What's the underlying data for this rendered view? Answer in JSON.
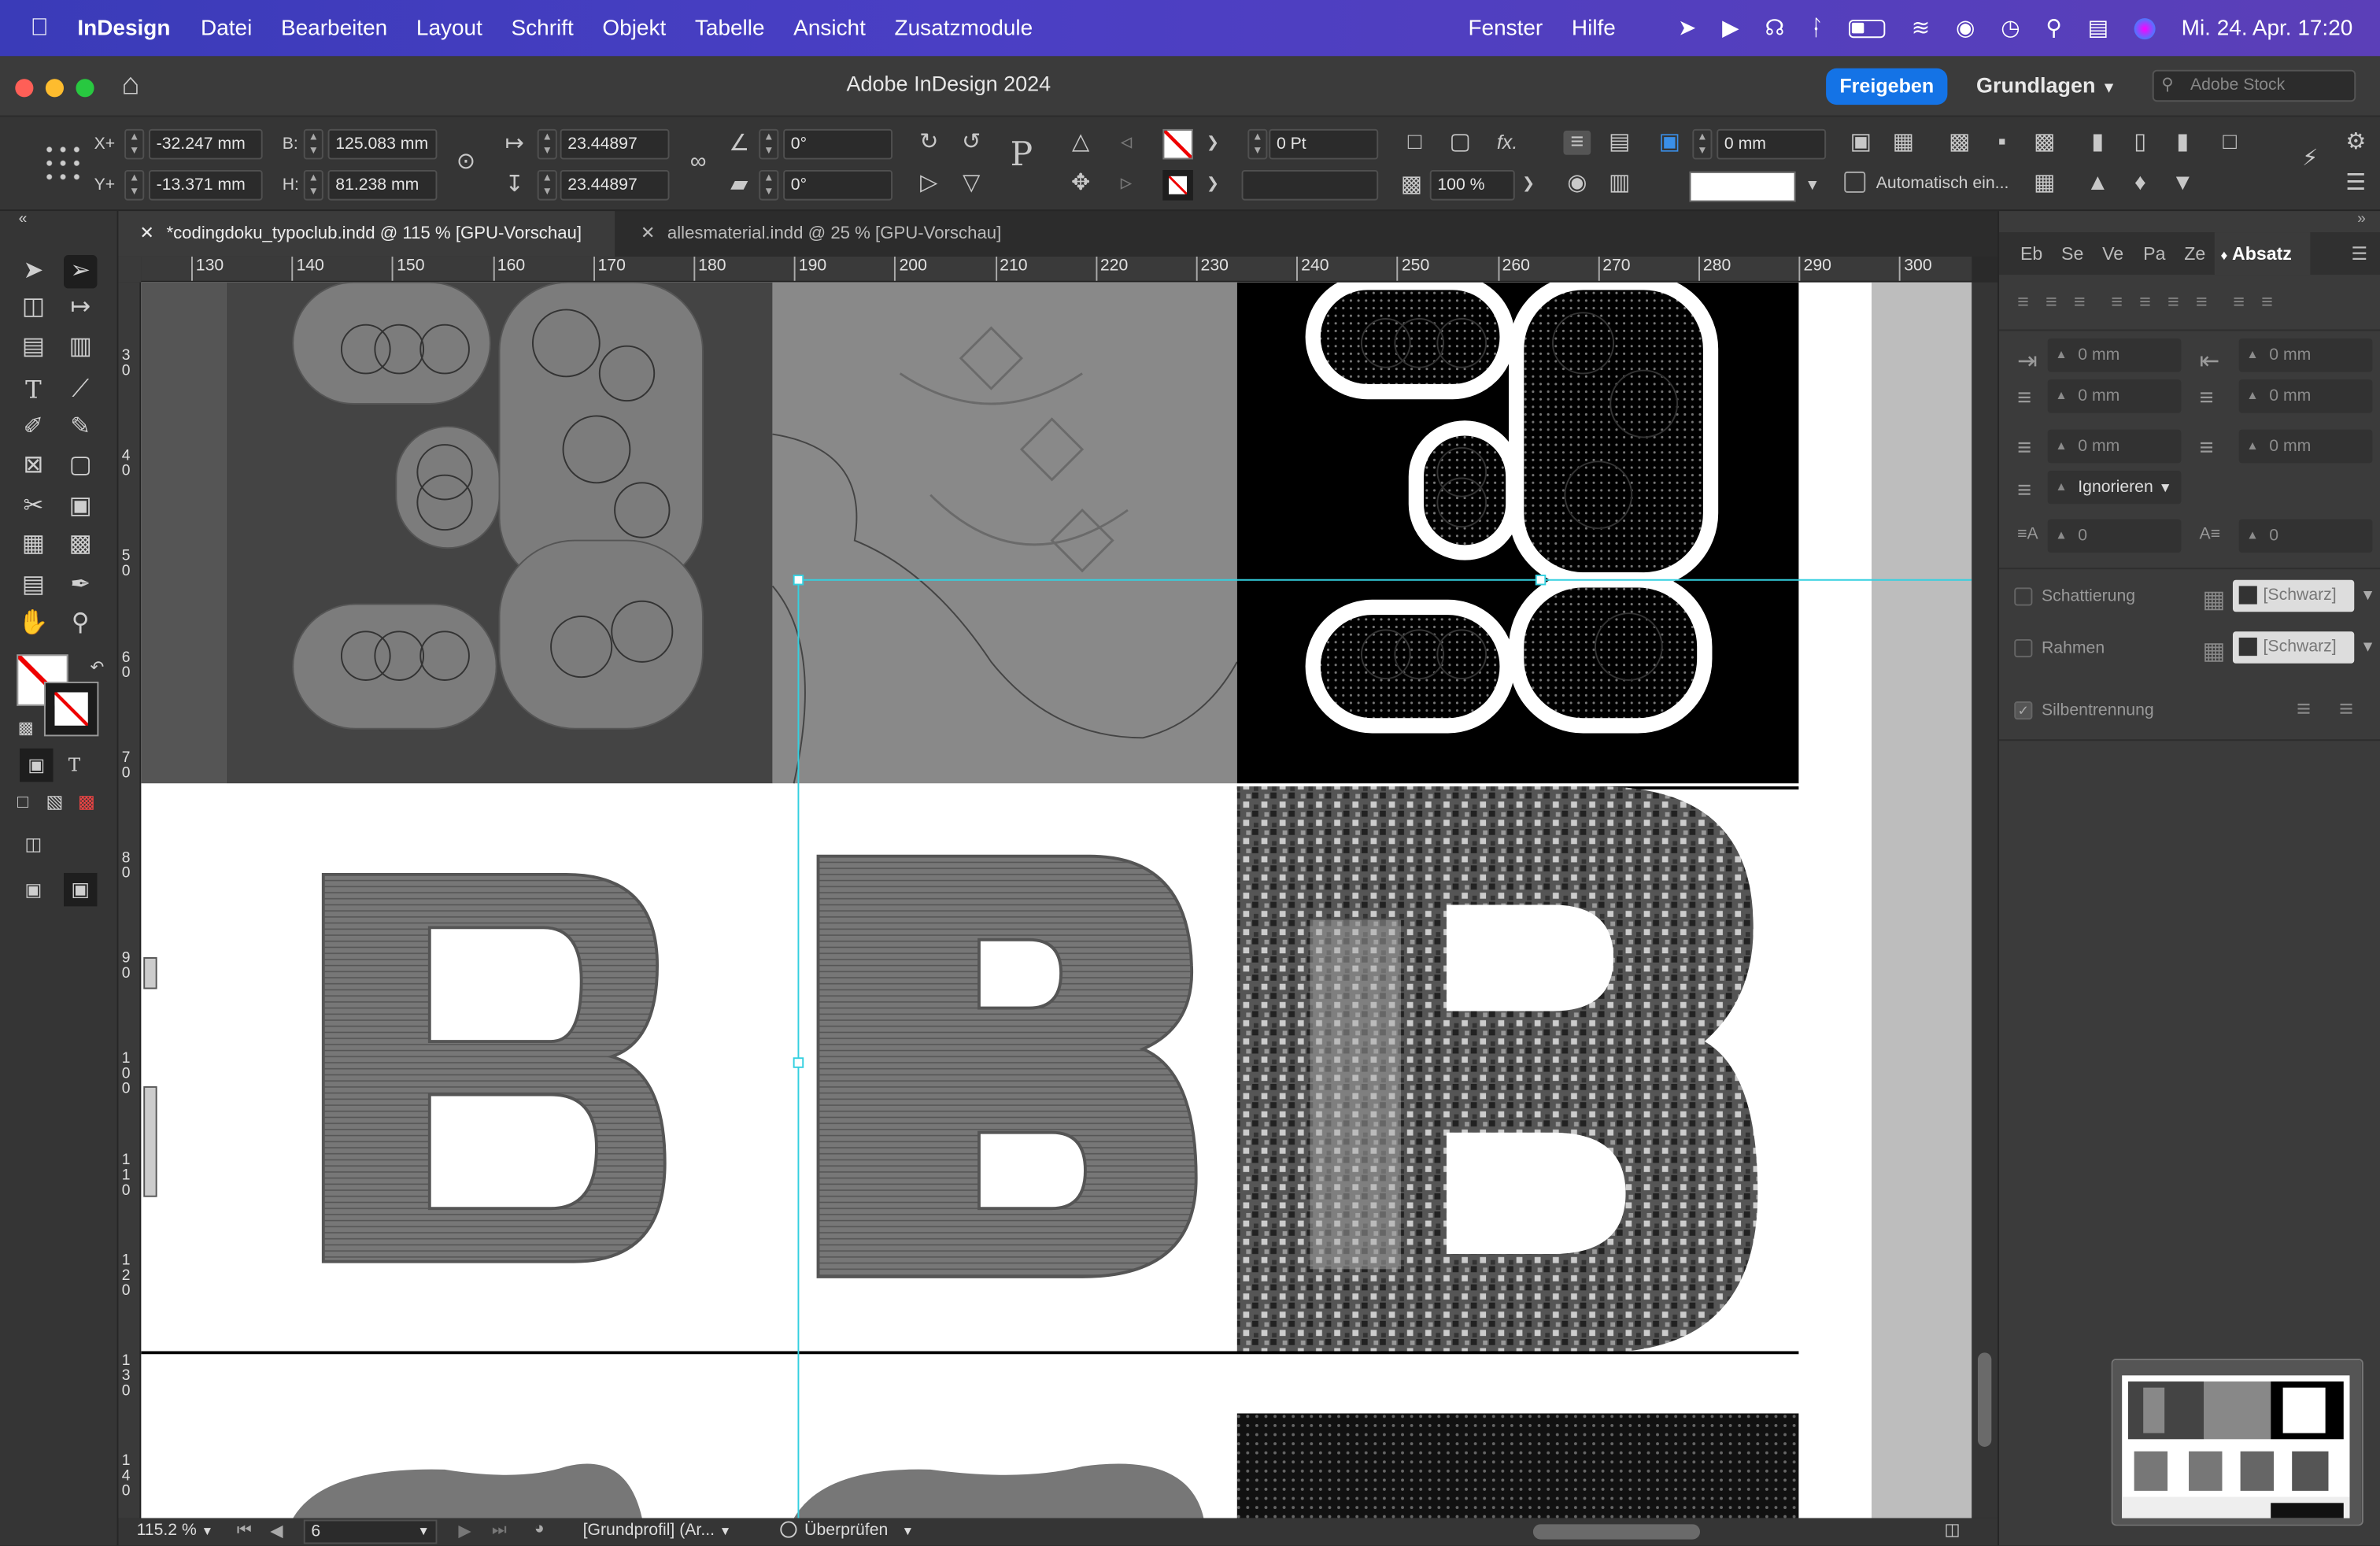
{
  "menubar": {
    "app": "InDesign",
    "items": [
      "Datei",
      "Bearbeiten",
      "Layout",
      "Schrift",
      "Objekt",
      "Tabelle",
      "Ansicht",
      "Zusatzmodule"
    ],
    "right_items": [
      "Fenster",
      "Hilfe"
    ],
    "clock": "Mi. 24. Apr.  17:20"
  },
  "window": {
    "title": "Adobe InDesign 2024",
    "share_label": "Freigeben",
    "workspace": "Grundlagen",
    "stock_placeholder": "Adobe Stock"
  },
  "control": {
    "x_label": "X+",
    "x": "-32.247 mm",
    "y_label": "Y+",
    "y": "-13.371 mm",
    "w_label": "B:",
    "w": "125.083 mm",
    "h_label": "H:",
    "h": "81.238 mm",
    "scale_x": "23.44897",
    "scale_y": "23.44897",
    "angle": "0°",
    "shear": "0°",
    "stroke_weight": "0 Pt",
    "opacity": "100 %",
    "offset": "0 mm",
    "auto_fit_label": "Automatisch ein..."
  },
  "tabs": [
    {
      "label": "*codingdoku_typoclub.indd @ 115 % [GPU-Vorschau]",
      "active": true
    },
    {
      "label": "allesmaterial.indd @ 25 % [GPU-Vorschau]",
      "active": false
    }
  ],
  "hruler": [
    "130",
    "140",
    "150",
    "160",
    "170",
    "180",
    "190",
    "200",
    "210",
    "220",
    "230",
    "240",
    "250",
    "260",
    "270",
    "280",
    "290",
    "300"
  ],
  "vruler": [
    "3 0",
    "4 0",
    "5 0",
    "6 0",
    "7 0",
    "8 0",
    "9 0",
    "1 0 0",
    "1 1 0",
    "1 2 0",
    "1 3 0",
    "1 4 0"
  ],
  "panel": {
    "tabs": [
      "Eb",
      "Se",
      "Ve",
      "Pa",
      "Ze",
      "Absatz"
    ],
    "indent_left": "0 mm",
    "indent_right": "0 mm",
    "first_line": "0 mm",
    "last_line": "0 mm",
    "space_before": "0 mm",
    "space_after": "0 mm",
    "align_grid": "Ignorieren",
    "dropcap_lines": "0",
    "dropcap_chars": "0",
    "shading_label": "Schattierung",
    "shading_color": "[Schwarz]",
    "frame_label": "Rahmen",
    "frame_color": "[Schwarz]",
    "hyphenation_label": "Silbentrennung"
  },
  "status": {
    "zoom": "115.2 %",
    "page": "6",
    "profile": "[Grundprofil] (Ar...",
    "preflight": "Überprüfen"
  },
  "colors": {
    "menubar": "#3a3bb8",
    "accent": "#1473e6",
    "guide": "#34d0e0"
  }
}
